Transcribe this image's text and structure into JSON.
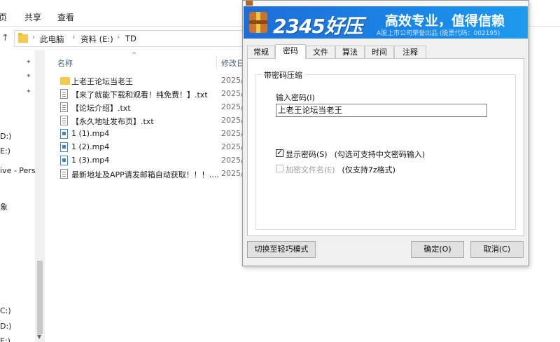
{
  "explorer": {
    "ribbon_tabs": [
      "页",
      "共享",
      "查看"
    ],
    "breadcrumb": [
      "此电脑",
      "资料 (E:)",
      "TD"
    ],
    "nav_items": [
      "D:)",
      "E:)",
      "ive - Perso",
      "象",
      "C:)",
      "D:)",
      "E:)"
    ],
    "columns": {
      "name": "名称",
      "date": "修改日"
    },
    "files": [
      {
        "name": "上老王论坛当老王",
        "type": "folder",
        "date": "2025/"
      },
      {
        "name": "【来了就能下载和观看！纯免费！】.txt",
        "type": "txt",
        "date": "2025/"
      },
      {
        "name": "【论坛介绍】.txt",
        "type": "txt",
        "date": "2025/"
      },
      {
        "name": "【永久地址发布页】.txt",
        "type": "txt",
        "date": "2025/"
      },
      {
        "name": "1 (1).mp4",
        "type": "mp4",
        "date": "2025/"
      },
      {
        "name": "1 (2).mp4",
        "type": "mp4",
        "date": "2025/"
      },
      {
        "name": "1 (3).mp4",
        "type": "mp4",
        "date": "2025/"
      },
      {
        "name": "最新地址及APP请发邮箱自动获取！！！....",
        "type": "txt",
        "date": "2025/"
      }
    ]
  },
  "dialog": {
    "banner": {
      "brand": "2345好压",
      "slogan": "高效专业，值得信赖",
      "sub": "A股上市公司荣誉出品 (股票代码：002195)"
    },
    "tabs": [
      "常规",
      "密码",
      "文件",
      "算法",
      "时间",
      "注释"
    ],
    "active_tab": "密码",
    "group_title": "带密码压缩",
    "password_label": "输入密码(I)",
    "password_value": "上老王论坛当老王",
    "show_password": {
      "label": "显示密码(S)",
      "hint": "(勾选可支持中文密码输入)",
      "checked": true
    },
    "encrypt_names": {
      "label": "加密文件名(E)",
      "hint": "(仅支持7z格式)",
      "checked": false,
      "disabled": true
    },
    "buttons": {
      "mode": "切换至轻巧模式",
      "ok": "确定(O)",
      "cancel": "取消(C)"
    }
  },
  "colors": {
    "banner_blue": "#1a86e6",
    "folder_yellow": "#f3c94f",
    "mp4_blue": "#4a7fc1"
  },
  "icons": {
    "folder": "folder-icon",
    "txt": "text-file-icon",
    "mp4": "video-file-icon",
    "pin": "pin-icon",
    "up": "arrow-up-icon"
  }
}
